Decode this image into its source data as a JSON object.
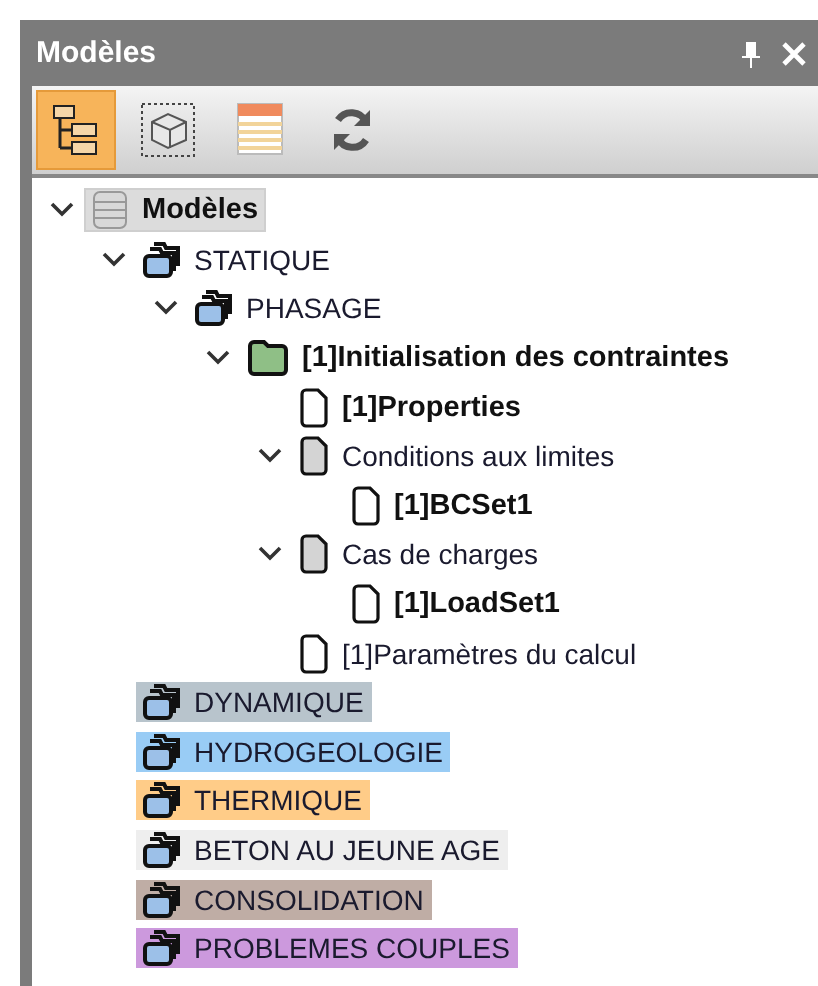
{
  "panel": {
    "title": "Modèles"
  },
  "toolbar": [
    {
      "kind": "tree",
      "selected": true
    },
    {
      "kind": "box",
      "selected": false
    },
    {
      "kind": "table",
      "selected": false
    },
    {
      "kind": "refresh",
      "selected": false
    }
  ],
  "tree": [
    {
      "label": "Modèles",
      "kind": "database",
      "bold": true,
      "selected": true,
      "expanded": true,
      "children": [
        {
          "label": "STATIQUE",
          "kind": "folders",
          "bold": false,
          "selected": false,
          "expanded": true,
          "children": [
            {
              "label": "PHASAGE",
              "kind": "folders",
              "bold": false,
              "selected": false,
              "expanded": true,
              "children": [
                {
                  "label": "[1]Initialisation des contraintes",
                  "kind": "folder",
                  "bold": true,
                  "selected": false,
                  "expanded": true,
                  "children": [
                    {
                      "label": "[1]Properties",
                      "kind": "page",
                      "bold": true,
                      "selected": false
                    },
                    {
                      "label": "Conditions aux limites",
                      "kind": "grey-page",
                      "bold": false,
                      "selected": false,
                      "expanded": true,
                      "children": [
                        {
                          "label": "[1]BCSet1",
                          "kind": "page",
                          "bold": true,
                          "selected": false
                        }
                      ]
                    },
                    {
                      "label": "Cas de charges",
                      "kind": "grey-page",
                      "bold": false,
                      "selected": false,
                      "expanded": true,
                      "children": [
                        {
                          "label": "[1]LoadSet1",
                          "kind": "page",
                          "bold": true,
                          "selected": false
                        }
                      ]
                    },
                    {
                      "label": "[1]Paramètres du calcul",
                      "kind": "page",
                      "bold": false,
                      "selected": false
                    }
                  ]
                }
              ]
            }
          ]
        },
        {
          "label": "DYNAMIQUE",
          "kind": "folders",
          "bold": false,
          "selected": false,
          "color": "#b8c4cc"
        },
        {
          "label": "HYDROGEOLOGIE",
          "kind": "folders",
          "bold": false,
          "selected": false,
          "color": "#99ccf5"
        },
        {
          "label": "THERMIQUE",
          "kind": "folders",
          "bold": false,
          "selected": false,
          "color": "#ffcc88"
        },
        {
          "label": "BETON AU JEUNE AGE",
          "kind": "folders",
          "bold": false,
          "selected": false,
          "color": "#eeeeee"
        },
        {
          "label": "CONSOLIDATION",
          "kind": "folders",
          "bold": false,
          "selected": false,
          "color": "#bfada5"
        },
        {
          "label": "PROBLEMES COUPLES",
          "kind": "folders",
          "bold": false,
          "selected": false,
          "color": "#cc99dd"
        }
      ]
    }
  ]
}
